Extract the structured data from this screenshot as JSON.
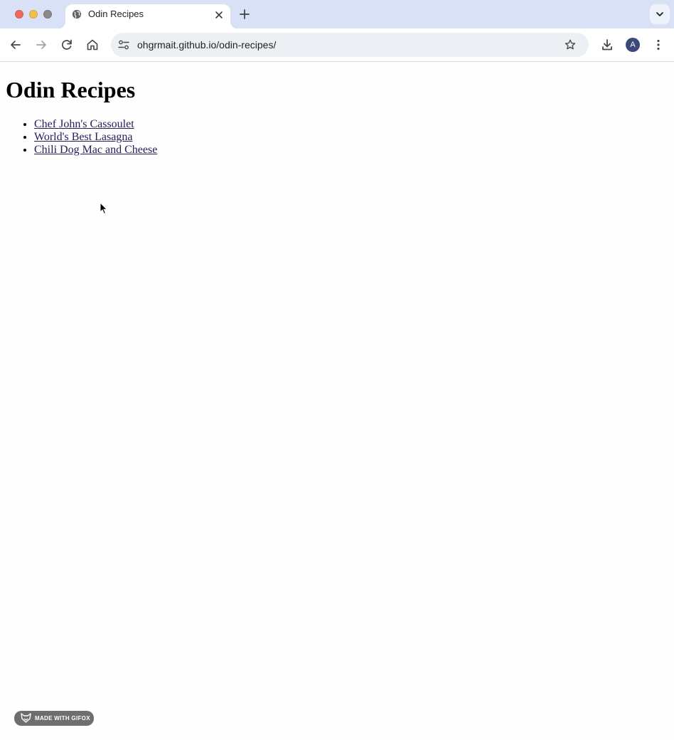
{
  "browser": {
    "tab": {
      "title": "Odin Recipes"
    },
    "address_bar": {
      "url": "ohgrmait.github.io/odin-recipes/"
    },
    "profile": {
      "initial": "A"
    },
    "icons": [
      "globe-icon",
      "close-icon",
      "plus-icon",
      "chevron-down-icon",
      "back-arrow-icon",
      "forward-arrow-icon",
      "reload-icon",
      "home-icon",
      "site-settings-icon",
      "star-icon",
      "download-icon",
      "more-vert-icon"
    ]
  },
  "page": {
    "title": "Odin Recipes",
    "recipes": [
      {
        "label": "Chef John's Cassoulet"
      },
      {
        "label": "World's Best Lasagna"
      },
      {
        "label": "Chili Dog Mac and Cheese"
      }
    ]
  },
  "watermark": {
    "label": "MADE WITH GIFOX"
  },
  "colors": {
    "tabstrip_bg": "#d9e1f6",
    "omnibox_bg": "#eceff4",
    "link": "#23205a",
    "avatar_bg": "#3b4a78"
  }
}
